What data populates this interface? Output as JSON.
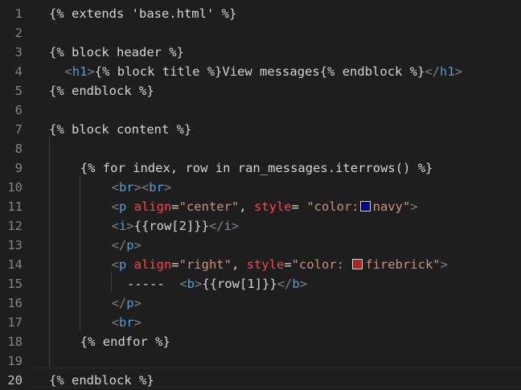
{
  "colors": {
    "navy": "#000080",
    "firebrick": "#b22222"
  },
  "lines": [
    {
      "n": "1",
      "indent": 0,
      "tokens": [
        {
          "t": "template",
          "v": "{% extends 'base.html' %}"
        }
      ]
    },
    {
      "n": "2",
      "indent": 0,
      "tokens": []
    },
    {
      "n": "3",
      "indent": 0,
      "tokens": [
        {
          "t": "template",
          "v": "{% block header %}"
        }
      ]
    },
    {
      "n": "4",
      "indent": 2,
      "tokens": [
        {
          "t": "punct",
          "v": "<"
        },
        {
          "t": "tag",
          "v": "h1"
        },
        {
          "t": "punct",
          "v": ">"
        },
        {
          "t": "template",
          "v": "{% block title %}View messages{% endblock %}"
        },
        {
          "t": "punct",
          "v": "</"
        },
        {
          "t": "tag",
          "v": "h1"
        },
        {
          "t": "punct",
          "v": ">"
        }
      ]
    },
    {
      "n": "5",
      "indent": 0,
      "tokens": [
        {
          "t": "template",
          "v": "{% endblock %}"
        }
      ]
    },
    {
      "n": "6",
      "indent": 0,
      "tokens": []
    },
    {
      "n": "7",
      "indent": 0,
      "tokens": [
        {
          "t": "template",
          "v": "{% block content %}"
        }
      ]
    },
    {
      "n": "8",
      "indent": 0,
      "tokens": []
    },
    {
      "n": "9",
      "indent": 4,
      "tokens": [
        {
          "t": "template",
          "v": "{% for index, row in ran_messages.iterrows() %}"
        }
      ]
    },
    {
      "n": "10",
      "indent": 8,
      "tokens": [
        {
          "t": "punct",
          "v": "<"
        },
        {
          "t": "tag",
          "v": "br"
        },
        {
          "t": "punct",
          "v": "><"
        },
        {
          "t": "tag",
          "v": "br"
        },
        {
          "t": "punct",
          "v": ">"
        }
      ]
    },
    {
      "n": "11",
      "indent": 8,
      "tokens": [
        {
          "t": "punct",
          "v": "<"
        },
        {
          "t": "tag",
          "v": "p"
        },
        {
          "t": "text",
          "v": " "
        },
        {
          "t": "attr",
          "v": "align"
        },
        {
          "t": "text",
          "v": "="
        },
        {
          "t": "str",
          "v": "\"center\""
        },
        {
          "t": "text",
          "v": ", "
        },
        {
          "t": "attr",
          "v": "style"
        },
        {
          "t": "text",
          "v": "= "
        },
        {
          "t": "str",
          "v": "\"color:"
        },
        {
          "t": "swatch",
          "v": "navy"
        },
        {
          "t": "str",
          "v": "navy\""
        },
        {
          "t": "punct",
          "v": ">"
        }
      ]
    },
    {
      "n": "12",
      "indent": 8,
      "tokens": [
        {
          "t": "punct",
          "v": "<"
        },
        {
          "t": "tag",
          "v": "i"
        },
        {
          "t": "punct",
          "v": ">"
        },
        {
          "t": "text",
          "v": "{{row[2]}}"
        },
        {
          "t": "punct",
          "v": "</"
        },
        {
          "t": "tag",
          "v": "i"
        },
        {
          "t": "punct",
          "v": ">"
        }
      ]
    },
    {
      "n": "13",
      "indent": 8,
      "tokens": [
        {
          "t": "punct",
          "v": "</"
        },
        {
          "t": "tag",
          "v": "p"
        },
        {
          "t": "punct",
          "v": ">"
        }
      ]
    },
    {
      "n": "14",
      "indent": 8,
      "tokens": [
        {
          "t": "punct",
          "v": "<"
        },
        {
          "t": "tag",
          "v": "p"
        },
        {
          "t": "text",
          "v": " "
        },
        {
          "t": "attr",
          "v": "align"
        },
        {
          "t": "text",
          "v": "="
        },
        {
          "t": "str",
          "v": "\"right\""
        },
        {
          "t": "text",
          "v": ", "
        },
        {
          "t": "attr",
          "v": "style"
        },
        {
          "t": "text",
          "v": "="
        },
        {
          "t": "str",
          "v": "\"color: "
        },
        {
          "t": "swatch",
          "v": "firebrick"
        },
        {
          "t": "str",
          "v": "firebrick\""
        },
        {
          "t": "punct",
          "v": ">"
        }
      ]
    },
    {
      "n": "15",
      "indent": 10,
      "tokens": [
        {
          "t": "text",
          "v": "-----  "
        },
        {
          "t": "punct",
          "v": "<"
        },
        {
          "t": "tag",
          "v": "b"
        },
        {
          "t": "punct",
          "v": ">"
        },
        {
          "t": "text",
          "v": "{{row[1]}}"
        },
        {
          "t": "punct",
          "v": "</"
        },
        {
          "t": "tag",
          "v": "b"
        },
        {
          "t": "punct",
          "v": ">"
        }
      ]
    },
    {
      "n": "16",
      "indent": 8,
      "tokens": [
        {
          "t": "punct",
          "v": "</"
        },
        {
          "t": "tag",
          "v": "p"
        },
        {
          "t": "punct",
          "v": ">"
        }
      ]
    },
    {
      "n": "17",
      "indent": 8,
      "tokens": [
        {
          "t": "punct",
          "v": "<"
        },
        {
          "t": "tag",
          "v": "br"
        },
        {
          "t": "punct",
          "v": ">"
        }
      ]
    },
    {
      "n": "18",
      "indent": 4,
      "tokens": [
        {
          "t": "template",
          "v": "{% endfor %}"
        }
      ]
    },
    {
      "n": "19",
      "indent": 0,
      "tokens": []
    },
    {
      "n": "20",
      "indent": 0,
      "active": true,
      "tokens": [
        {
          "t": "template",
          "v": "{% endblock %}"
        }
      ]
    }
  ]
}
